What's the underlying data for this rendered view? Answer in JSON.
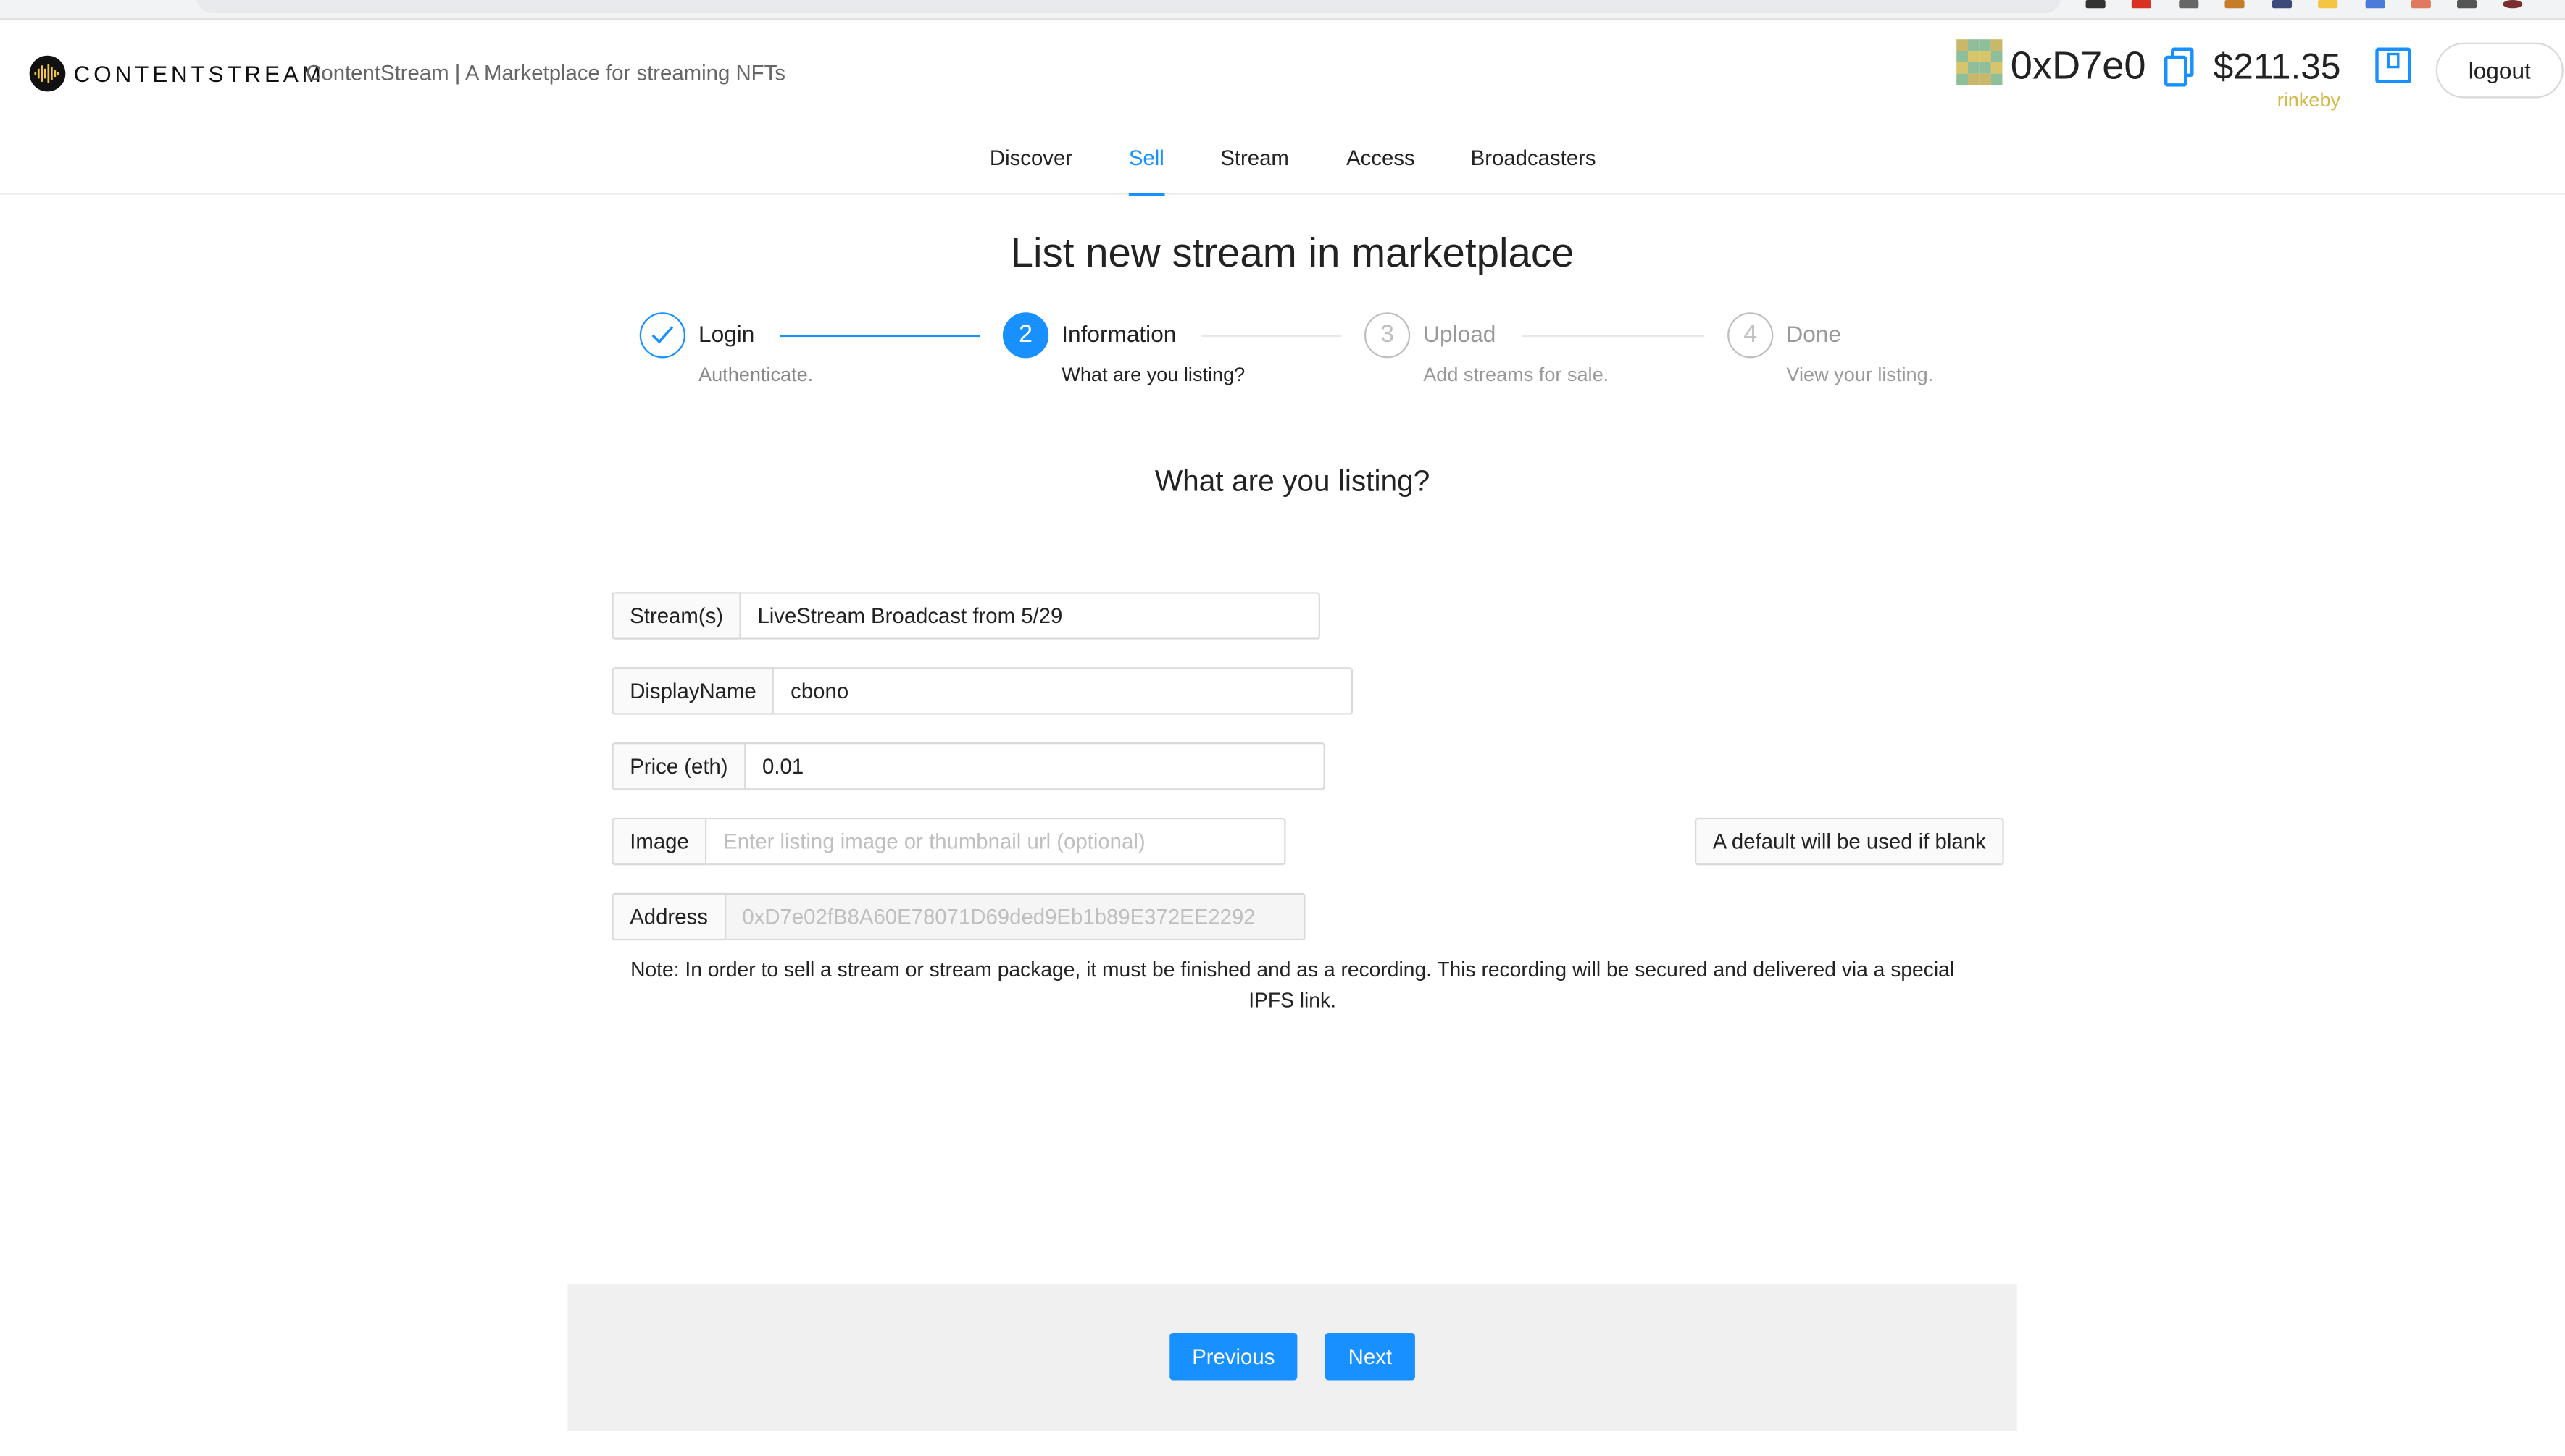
{
  "header": {
    "logo_text": "CONTENTSTREAM",
    "tagline": "ContentStream | A Marketplace for streaming NFTs",
    "address": "0xD7e0",
    "balance": "$211.35",
    "network": "rinkeby",
    "logout_label": "logout",
    "network_color": "#d4b848"
  },
  "nav": {
    "items": [
      {
        "label": "Discover"
      },
      {
        "label": "Sell"
      },
      {
        "label": "Stream"
      },
      {
        "label": "Access"
      },
      {
        "label": "Broadcasters"
      }
    ],
    "active": "Sell",
    "accent_color": "#1890ff"
  },
  "page": {
    "title": "List new stream in marketplace",
    "section_title": "What are you listing?"
  },
  "steps": [
    {
      "number": "1",
      "title": "Login",
      "description": "Authenticate.",
      "status": "done"
    },
    {
      "number": "2",
      "title": "Information",
      "description": "What are you listing?",
      "status": "current"
    },
    {
      "number": "3",
      "title": "Upload",
      "description": "Add streams for sale.",
      "status": "pending"
    },
    {
      "number": "4",
      "title": "Done",
      "description": "View your listing.",
      "status": "pending"
    }
  ],
  "form": {
    "streams": {
      "label": "Stream(s)",
      "value": "LiveStream Broadcast from 5/29"
    },
    "display_name": {
      "label": "DisplayName",
      "value": "cbono"
    },
    "price": {
      "label": "Price (eth)",
      "value": "0.01"
    },
    "image": {
      "label": "Image",
      "placeholder": "Enter listing image or thumbnail url (optional)",
      "hint": "A default will be used if blank"
    },
    "address": {
      "label": "Address",
      "value": "0xD7e02fB8A60E78071D69ded9Eb1b89E372EE2292"
    }
  },
  "note": "Note: In order to sell a stream or stream package, it must be finished and as a recording. This recording will be secured and delivered via a special IPFS link.",
  "footer": {
    "previous_label": "Previous",
    "next_label": "Next"
  }
}
